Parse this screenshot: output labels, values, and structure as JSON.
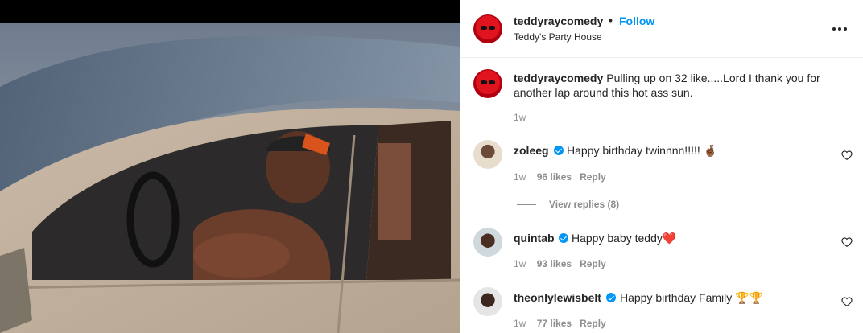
{
  "post": {
    "username": "teddyraycomedy",
    "separator": "•",
    "follow_label": "Follow",
    "location": "Teddy's Party House",
    "caption": "Pulling up on 32 like.....Lord I thank you for another lap around this hot ass sun.",
    "caption_time": "1w",
    "more_icon": "more-horizontal-icon"
  },
  "comments": [
    {
      "username": "zoleeg",
      "verified": true,
      "text": "Happy birthday twinnnn!!!!! 🤞🏾",
      "time": "1w",
      "likes": "96 likes",
      "reply_label": "Reply"
    },
    {
      "username": "quintab",
      "verified": true,
      "text": "Happy baby teddy❤️",
      "time": "1w",
      "likes": "93 likes",
      "reply_label": "Reply"
    },
    {
      "username": "theonlylewisbelt",
      "verified": true,
      "text": "Happy birthday Family 🏆🏆",
      "time": "1w",
      "likes": "77 likes",
      "reply_label": "Reply"
    }
  ],
  "view_replies_label": "View replies (8)",
  "colors": {
    "link": "#0095f6",
    "text": "#262626",
    "muted": "#8e8e8e",
    "border": "#efefef"
  }
}
